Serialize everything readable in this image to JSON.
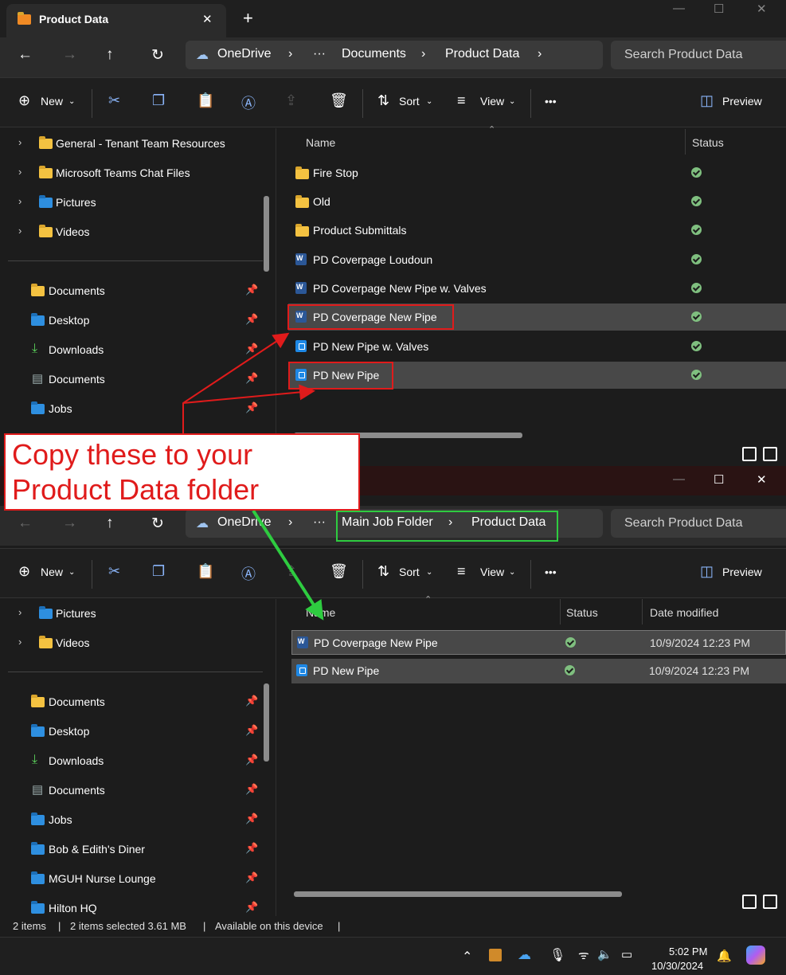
{
  "window1": {
    "tab_title": "Product Data",
    "tab_close": "✕",
    "new_tab": "+",
    "address": {
      "root": "OneDrive",
      "more": "···",
      "crumb1": "Documents",
      "crumb2": "Product Data"
    },
    "search_placeholder": "Search Product Data",
    "toolbar": {
      "new": "New",
      "sort": "Sort",
      "view": "View",
      "more": "•••",
      "preview": "Preview"
    },
    "nav_top": [
      {
        "label": "General - Tenant Team Resources"
      },
      {
        "label": "Microsoft Teams Chat Files"
      },
      {
        "label": "Pictures"
      },
      {
        "label": "Videos"
      }
    ],
    "nav_quick": [
      {
        "label": "Documents"
      },
      {
        "label": "Desktop"
      },
      {
        "label": "Downloads"
      },
      {
        "label": "Documents"
      },
      {
        "label": "Jobs"
      }
    ],
    "columns": {
      "name": "Name",
      "status": "Status"
    },
    "files": [
      {
        "name": "Fire Stop",
        "type": "folder"
      },
      {
        "name": "Old",
        "type": "folder"
      },
      {
        "name": "Product Submittals",
        "type": "folder"
      },
      {
        "name": "PD Coverpage Loudoun",
        "type": "word"
      },
      {
        "name": "PD Coverpage New Pipe w. Valves",
        "type": "word"
      },
      {
        "name": "PD Coverpage New Pipe",
        "type": "word"
      },
      {
        "name": "PD New Pipe w. Valves",
        "type": "pdf"
      },
      {
        "name": "PD New Pipe",
        "type": "pdf"
      }
    ]
  },
  "callout": {
    "line1": "Copy these to your",
    "line2": "Product Data folder"
  },
  "window2": {
    "address": {
      "root": "OneDrive",
      "more": "···",
      "crumb1": "Main Job Folder",
      "crumb2": "Product Data"
    },
    "search_placeholder": "Search Product Data",
    "toolbar": {
      "new": "New",
      "sort": "Sort",
      "view": "View",
      "more": "•••",
      "preview": "Preview"
    },
    "nav_top": [
      {
        "label": "Pictures"
      },
      {
        "label": "Videos"
      }
    ],
    "nav_quick": [
      {
        "label": "Documents"
      },
      {
        "label": "Desktop"
      },
      {
        "label": "Downloads"
      },
      {
        "label": "Documents"
      },
      {
        "label": "Jobs"
      },
      {
        "label": "Bob & Edith's Diner"
      },
      {
        "label": "MGUH Nurse Lounge"
      },
      {
        "label": "Hilton HQ"
      }
    ],
    "columns": {
      "name": "Name",
      "status": "Status",
      "date": "Date modified"
    },
    "files": [
      {
        "name": "PD Coverpage New Pipe",
        "type": "word",
        "date": "10/9/2024 12:23 PM"
      },
      {
        "name": "PD New Pipe",
        "type": "pdf",
        "date": "10/9/2024 12:23 PM"
      }
    ],
    "statusbar": {
      "items": "2 items",
      "selected": "2 items selected  3.61 MB",
      "availability": "Available on this device"
    }
  },
  "taskbar": {
    "time": "5:02 PM",
    "date": "10/30/2024"
  },
  "colors": {
    "annotation_red": "#e01b1b",
    "annotation_green": "#2ecc40",
    "accent": "#8ab4f8"
  }
}
